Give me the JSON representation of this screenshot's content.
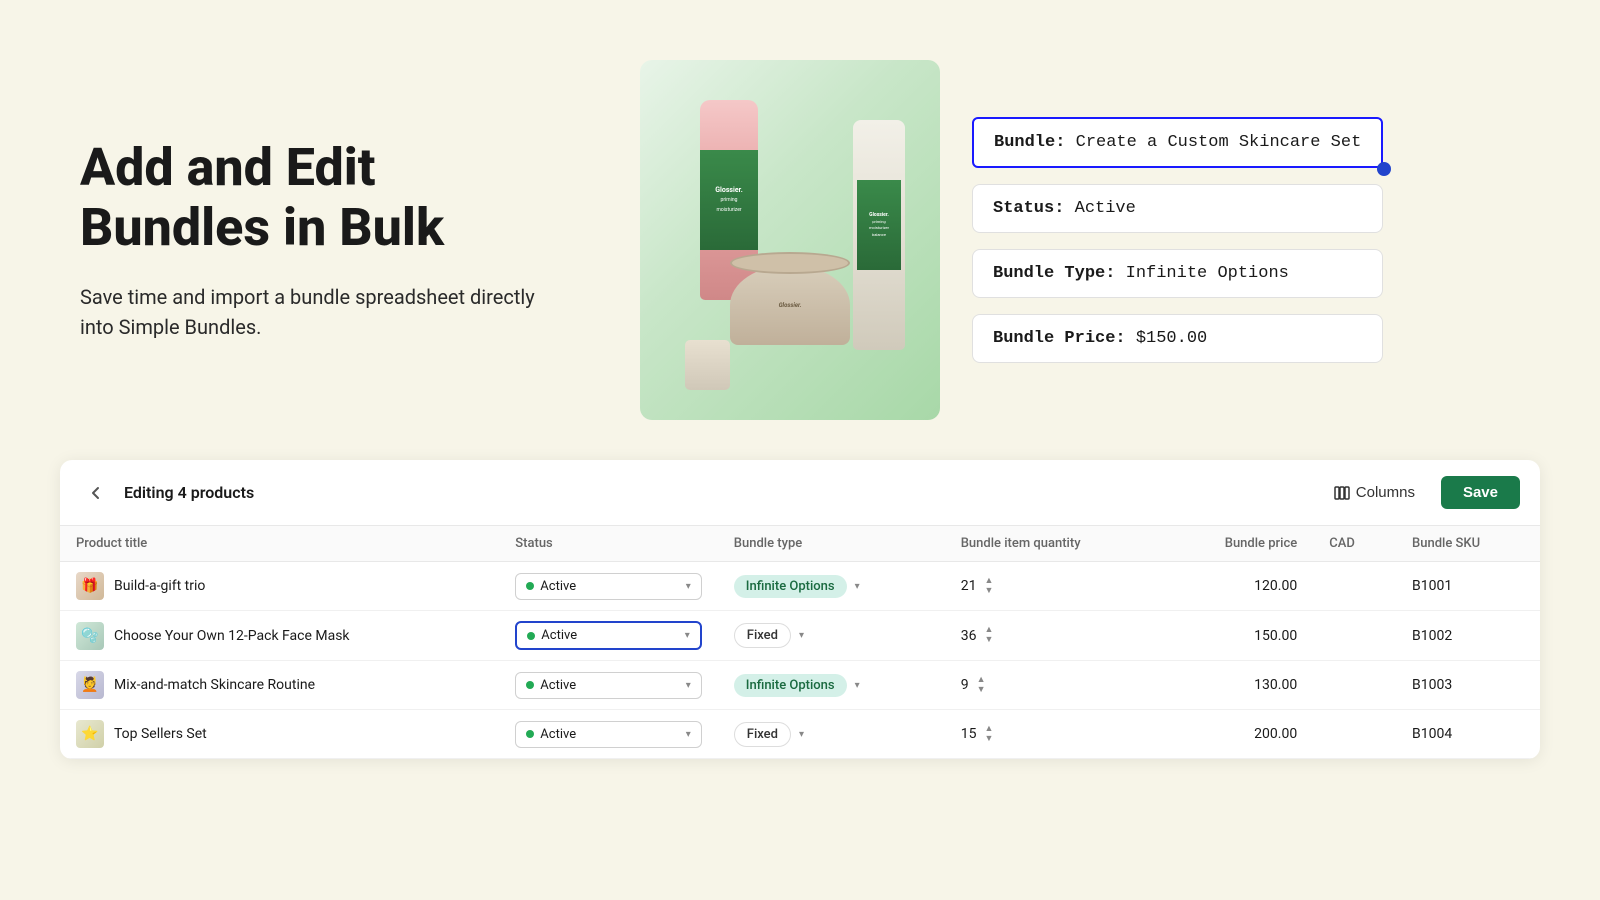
{
  "hero": {
    "title": "Add and Edit Bundles in Bulk",
    "subtitle": "Save time and import a bundle spreadsheet directly into Simple Bundles.",
    "info_cards": {
      "bundle_name_label": "Bundle:",
      "bundle_name_value": "Create a Custom Skincare Set",
      "status_label": "Status:",
      "status_value": "Active",
      "bundle_type_label": "Bundle Type:",
      "bundle_type_value": "Infinite Options",
      "bundle_price_label": "Bundle Price:",
      "bundle_price_value": "$150.00"
    }
  },
  "table": {
    "header": {
      "editing_label": "Editing 4 products",
      "columns_label": "Columns",
      "save_label": "Save"
    },
    "columns": {
      "product_title": "Product title",
      "status": "Status",
      "bundle_type": "Bundle type",
      "bundle_item_quantity": "Bundle item quantity",
      "bundle_price": "Bundle price",
      "currency": "CAD",
      "bundle_sku": "Bundle SKU"
    },
    "rows": [
      {
        "id": 1,
        "product_title": "Build-a-gift trio",
        "status": "Active",
        "bundle_type": "Infinite Options",
        "bundle_type_style": "infinite",
        "quantity": 21,
        "price": "120.00",
        "sku": "B1001",
        "icon_type": "gift"
      },
      {
        "id": 2,
        "product_title": "Choose Your Own 12-Pack Face Mask",
        "status": "Active",
        "bundle_type": "Fixed",
        "bundle_type_style": "fixed",
        "quantity": 36,
        "price": "150.00",
        "sku": "B1002",
        "icon_type": "mask",
        "highlight": true
      },
      {
        "id": 3,
        "product_title": "Mix-and-match Skincare Routine",
        "status": "Active",
        "bundle_type": "Infinite Options",
        "bundle_type_style": "infinite",
        "quantity": 9,
        "price": "130.00",
        "sku": "B1003",
        "icon_type": "routine"
      },
      {
        "id": 4,
        "product_title": "Top Sellers Set",
        "status": "Active",
        "bundle_type": "Fixed",
        "bundle_type_style": "fixed",
        "quantity": 15,
        "price": "200.00",
        "sku": "B1004",
        "icon_type": "sellers"
      }
    ]
  }
}
